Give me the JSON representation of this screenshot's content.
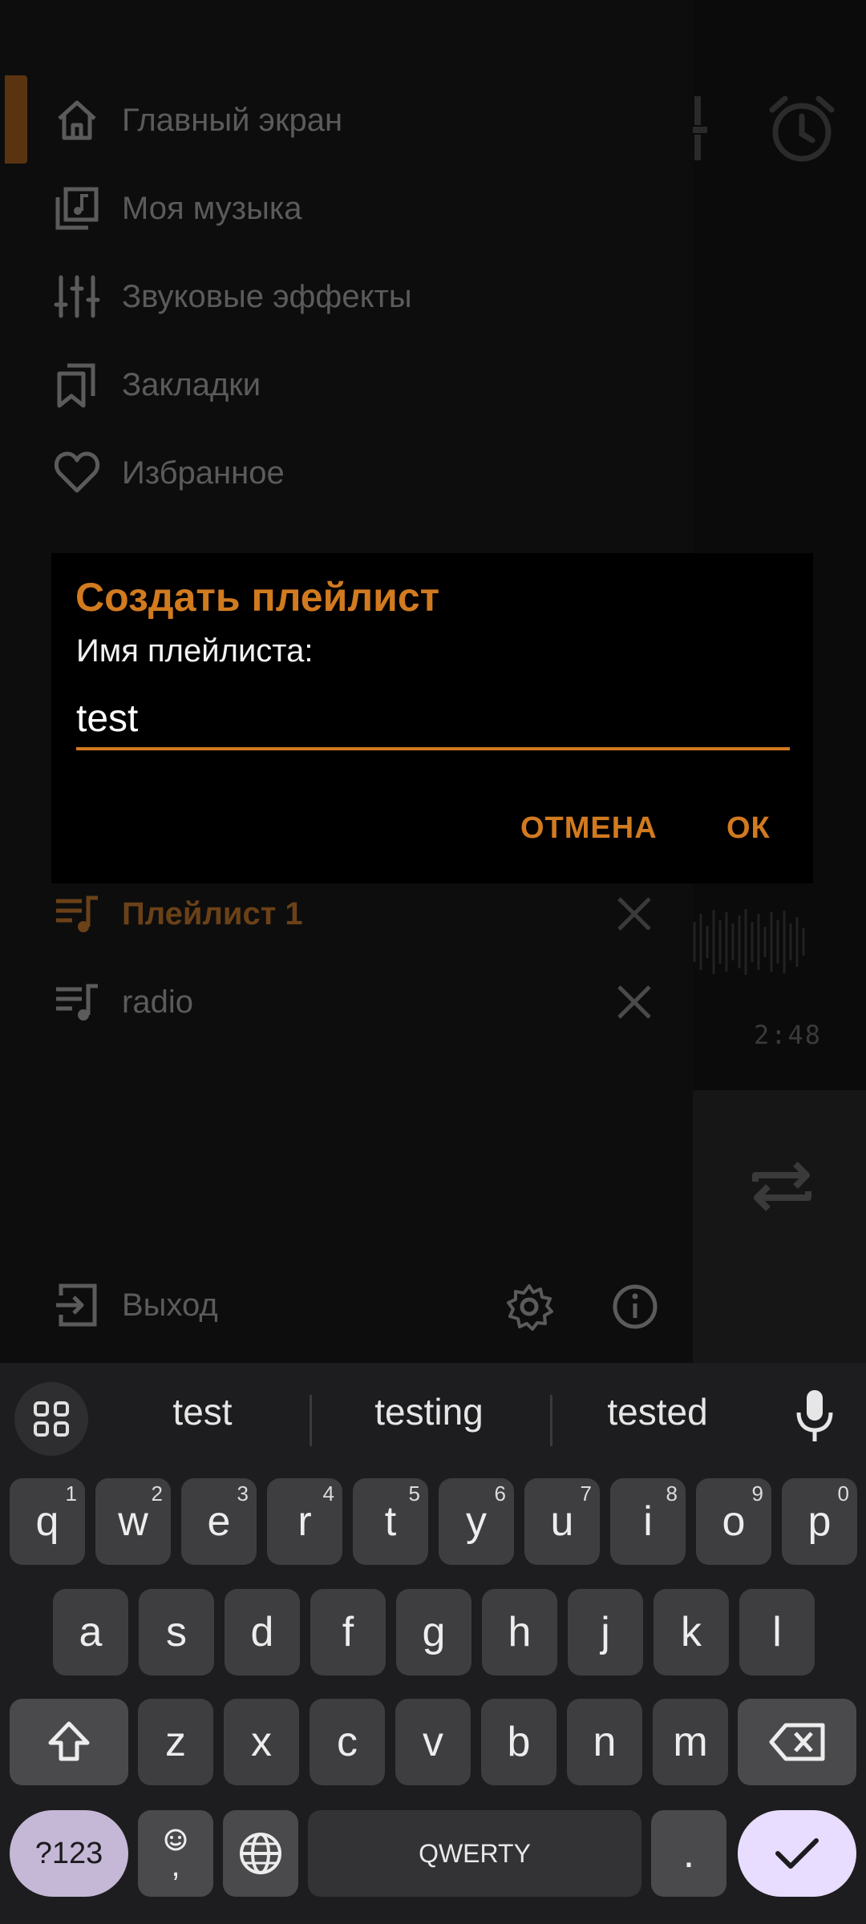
{
  "drawer": {
    "items": [
      {
        "label": "Главный экран",
        "icon": "home-icon"
      },
      {
        "label": "Моя музыка",
        "icon": "music-library-icon"
      },
      {
        "label": "Звуковые эффекты",
        "icon": "equalizer-icon"
      },
      {
        "label": "Закладки",
        "icon": "bookmarks-icon"
      },
      {
        "label": "Избранное",
        "icon": "heart-icon"
      }
    ],
    "playlists": [
      {
        "label": "Плейлист 1",
        "icon": "playlist-icon"
      },
      {
        "label": "radio",
        "icon": "playlist-icon"
      }
    ],
    "exit_label": "Выход",
    "accent": "#d17a1f"
  },
  "player": {
    "time": "2:48"
  },
  "dialog": {
    "title": "Создать плейлист",
    "label": "Имя плейлиста:",
    "input_value": "test",
    "cancel_label": "ОТМЕНА",
    "ok_label": "ОК"
  },
  "keyboard": {
    "suggestions": [
      "test",
      "testing",
      "tested"
    ],
    "row1": [
      {
        "k": "q",
        "n": "1"
      },
      {
        "k": "w",
        "n": "2"
      },
      {
        "k": "e",
        "n": "3"
      },
      {
        "k": "r",
        "n": "4"
      },
      {
        "k": "t",
        "n": "5"
      },
      {
        "k": "y",
        "n": "6"
      },
      {
        "k": "u",
        "n": "7"
      },
      {
        "k": "i",
        "n": "8"
      },
      {
        "k": "o",
        "n": "9"
      },
      {
        "k": "p",
        "n": "0"
      }
    ],
    "row2": [
      "a",
      "s",
      "d",
      "f",
      "g",
      "h",
      "j",
      "k",
      "l"
    ],
    "row3": [
      "z",
      "x",
      "c",
      "v",
      "b",
      "n",
      "m"
    ],
    "sym_label": "?123",
    "emoji_comma": ",",
    "space_label": "QWERTY",
    "period": "."
  }
}
